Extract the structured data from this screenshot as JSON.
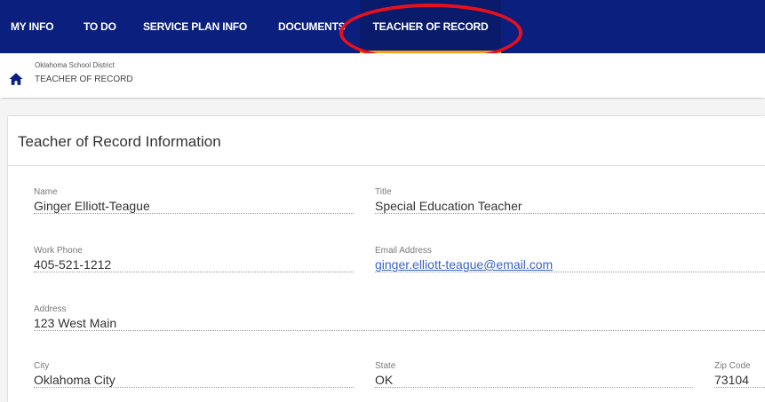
{
  "nav": {
    "items": [
      {
        "label": "MY INFO"
      },
      {
        "label": "TO DO"
      },
      {
        "label": "SERVICE PLAN INFO"
      },
      {
        "label": "DOCUMENTS"
      },
      {
        "label": "TEACHER OF RECORD",
        "active": true
      }
    ]
  },
  "breadcrumb": {
    "district": "Oklahoma School District",
    "page": "TEACHER OF RECORD"
  },
  "card": {
    "title": "Teacher of Record Information",
    "fields": {
      "name": {
        "label": "Name",
        "value": "Ginger Elliott-Teague"
      },
      "title": {
        "label": "Title",
        "value": "Special Education Teacher"
      },
      "work_phone": {
        "label": "Work Phone",
        "value": "405-521-1212"
      },
      "email": {
        "label": "Email Address",
        "value": "ginger.elliott-teague@email.com"
      },
      "address": {
        "label": "Address",
        "value": "123 West Main"
      },
      "city": {
        "label": "City",
        "value": "Oklahoma City"
      },
      "state": {
        "label": "State",
        "value": "OK"
      },
      "zip": {
        "label": "Zip Code",
        "value": "73104"
      }
    }
  },
  "colors": {
    "nav_background": "#0b1f7e",
    "active_tab_underline": "#f2a21a",
    "annotation_ring": "#e8101c",
    "link": "#3a63c9"
  },
  "icons": {
    "home": "home-icon"
  }
}
